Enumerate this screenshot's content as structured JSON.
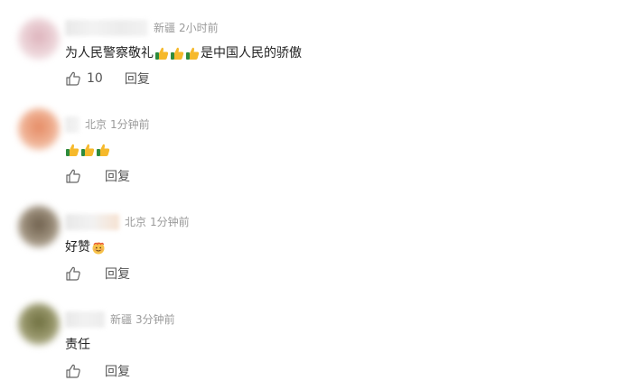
{
  "comments": [
    {
      "location": "新疆",
      "time": "2小时前",
      "text_before": "为人民警察敬礼",
      "text_after": "是中国人民的骄傲",
      "like_count": "10",
      "reply_label": "回复",
      "avatar_color": "#e9c9cf"
    },
    {
      "location": "北京",
      "time": "1分钟前",
      "like_count": "",
      "reply_label": "回复",
      "avatar_color": "#e6a07c"
    },
    {
      "location": "北京",
      "time": "1分钟前",
      "text": "好赞",
      "like_count": "",
      "reply_label": "回复",
      "avatar_color": "#8a7a66"
    },
    {
      "location": "新疆",
      "time": "3分钟前",
      "text": "责任",
      "like_count": "",
      "reply_label": "回复",
      "avatar_color": "#7f8055"
    }
  ],
  "icons": {
    "thumbs_up_emoji": "thumbs-up-emoji",
    "like": "thumbs-up-outline-icon",
    "emoji_love": "smiling-face-emoji"
  },
  "colors": {
    "meta": "#9a9a9a",
    "text": "#222222",
    "action": "#555555"
  }
}
